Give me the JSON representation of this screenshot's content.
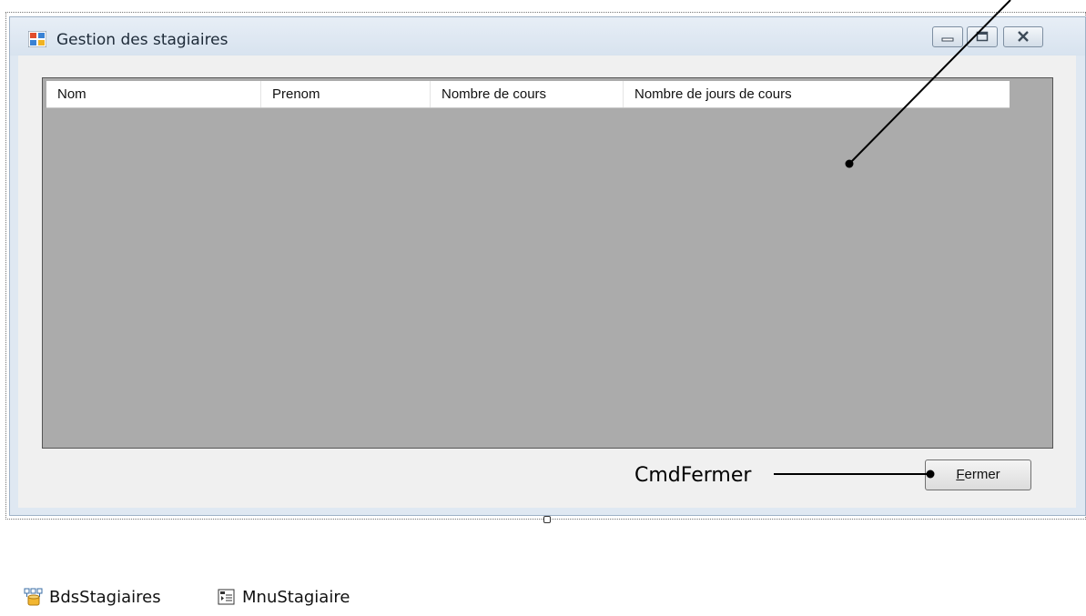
{
  "window": {
    "title": "Gestion des stagiaires",
    "icon": "form-icon",
    "controls": [
      "minimize-icon",
      "maximize-icon",
      "close-icon"
    ]
  },
  "grid": {
    "columns": [
      "Nom",
      "Prenom",
      "Nombre de cours",
      "Nombre de jours de cours"
    ],
    "rows": []
  },
  "button": {
    "fermer_label": "Fermer"
  },
  "annotations": {
    "cmdfermer_label": "CmdFermer"
  },
  "tray": {
    "items": [
      {
        "label": "BdsStagiaires",
        "icon": "binding-source-icon"
      },
      {
        "label": "MnuStagiaire",
        "icon": "menu-strip-icon"
      }
    ]
  },
  "colors": {
    "grid_background": "#ababab",
    "client_background": "#f0f0f0",
    "window_frame": "#dfe8f2"
  }
}
